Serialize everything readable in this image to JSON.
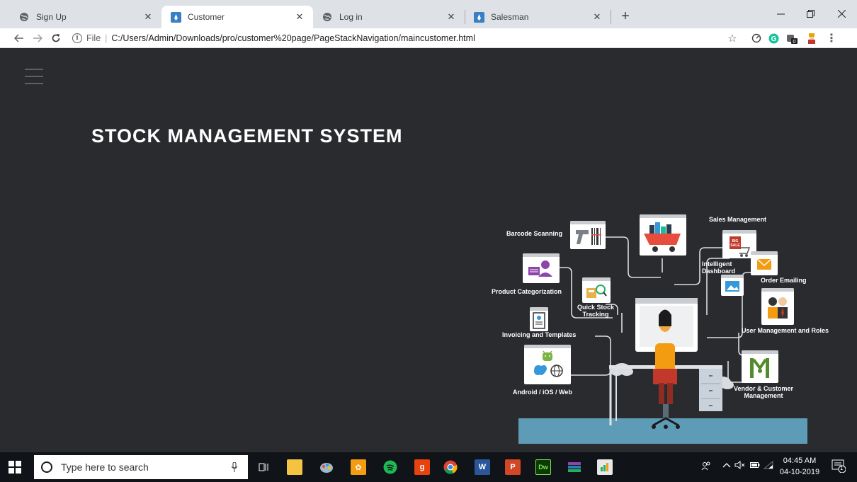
{
  "browser": {
    "tabs": [
      {
        "title": "Sign Up",
        "icon": "globe-icon"
      },
      {
        "title": "Customer",
        "icon": "page-icon",
        "active": true
      },
      {
        "title": "Log in",
        "icon": "globe-icon"
      },
      {
        "title": "Salesman",
        "icon": "page-icon"
      }
    ],
    "new_tab_label": "+",
    "url_prefix": "File",
    "url": "C:/Users/Admin/Downloads/pro/customer%20page/PageStackNavigation/maincustomer.html"
  },
  "page": {
    "heading": "STOCK MANAGEMENT SYSTEM",
    "illustration_labels": {
      "barcode": "Barcode Scanning",
      "sales": "Sales Management",
      "dashboard": "Intelligent\nDashboard",
      "order": "Order Emailing",
      "product": "Product Categorization",
      "quick_stock": "Quick Stock\nTracking",
      "invoicing": "Invoicing and Templates",
      "user_mgmt": "User Management and Roles",
      "android": "Android / iOS / Web",
      "vendor": "Vendor & Customer\nManagement"
    }
  },
  "taskbar": {
    "search_placeholder": "Type here to search",
    "time": "04:45 AM",
    "date": "04-10-2019",
    "notification_count": "1"
  },
  "colors": {
    "page_bg": "#2a2b2f",
    "tabstrip_bg": "#dee1e6",
    "taskbar_bg": "#101317",
    "desk_floor": "#5e9bb6"
  }
}
